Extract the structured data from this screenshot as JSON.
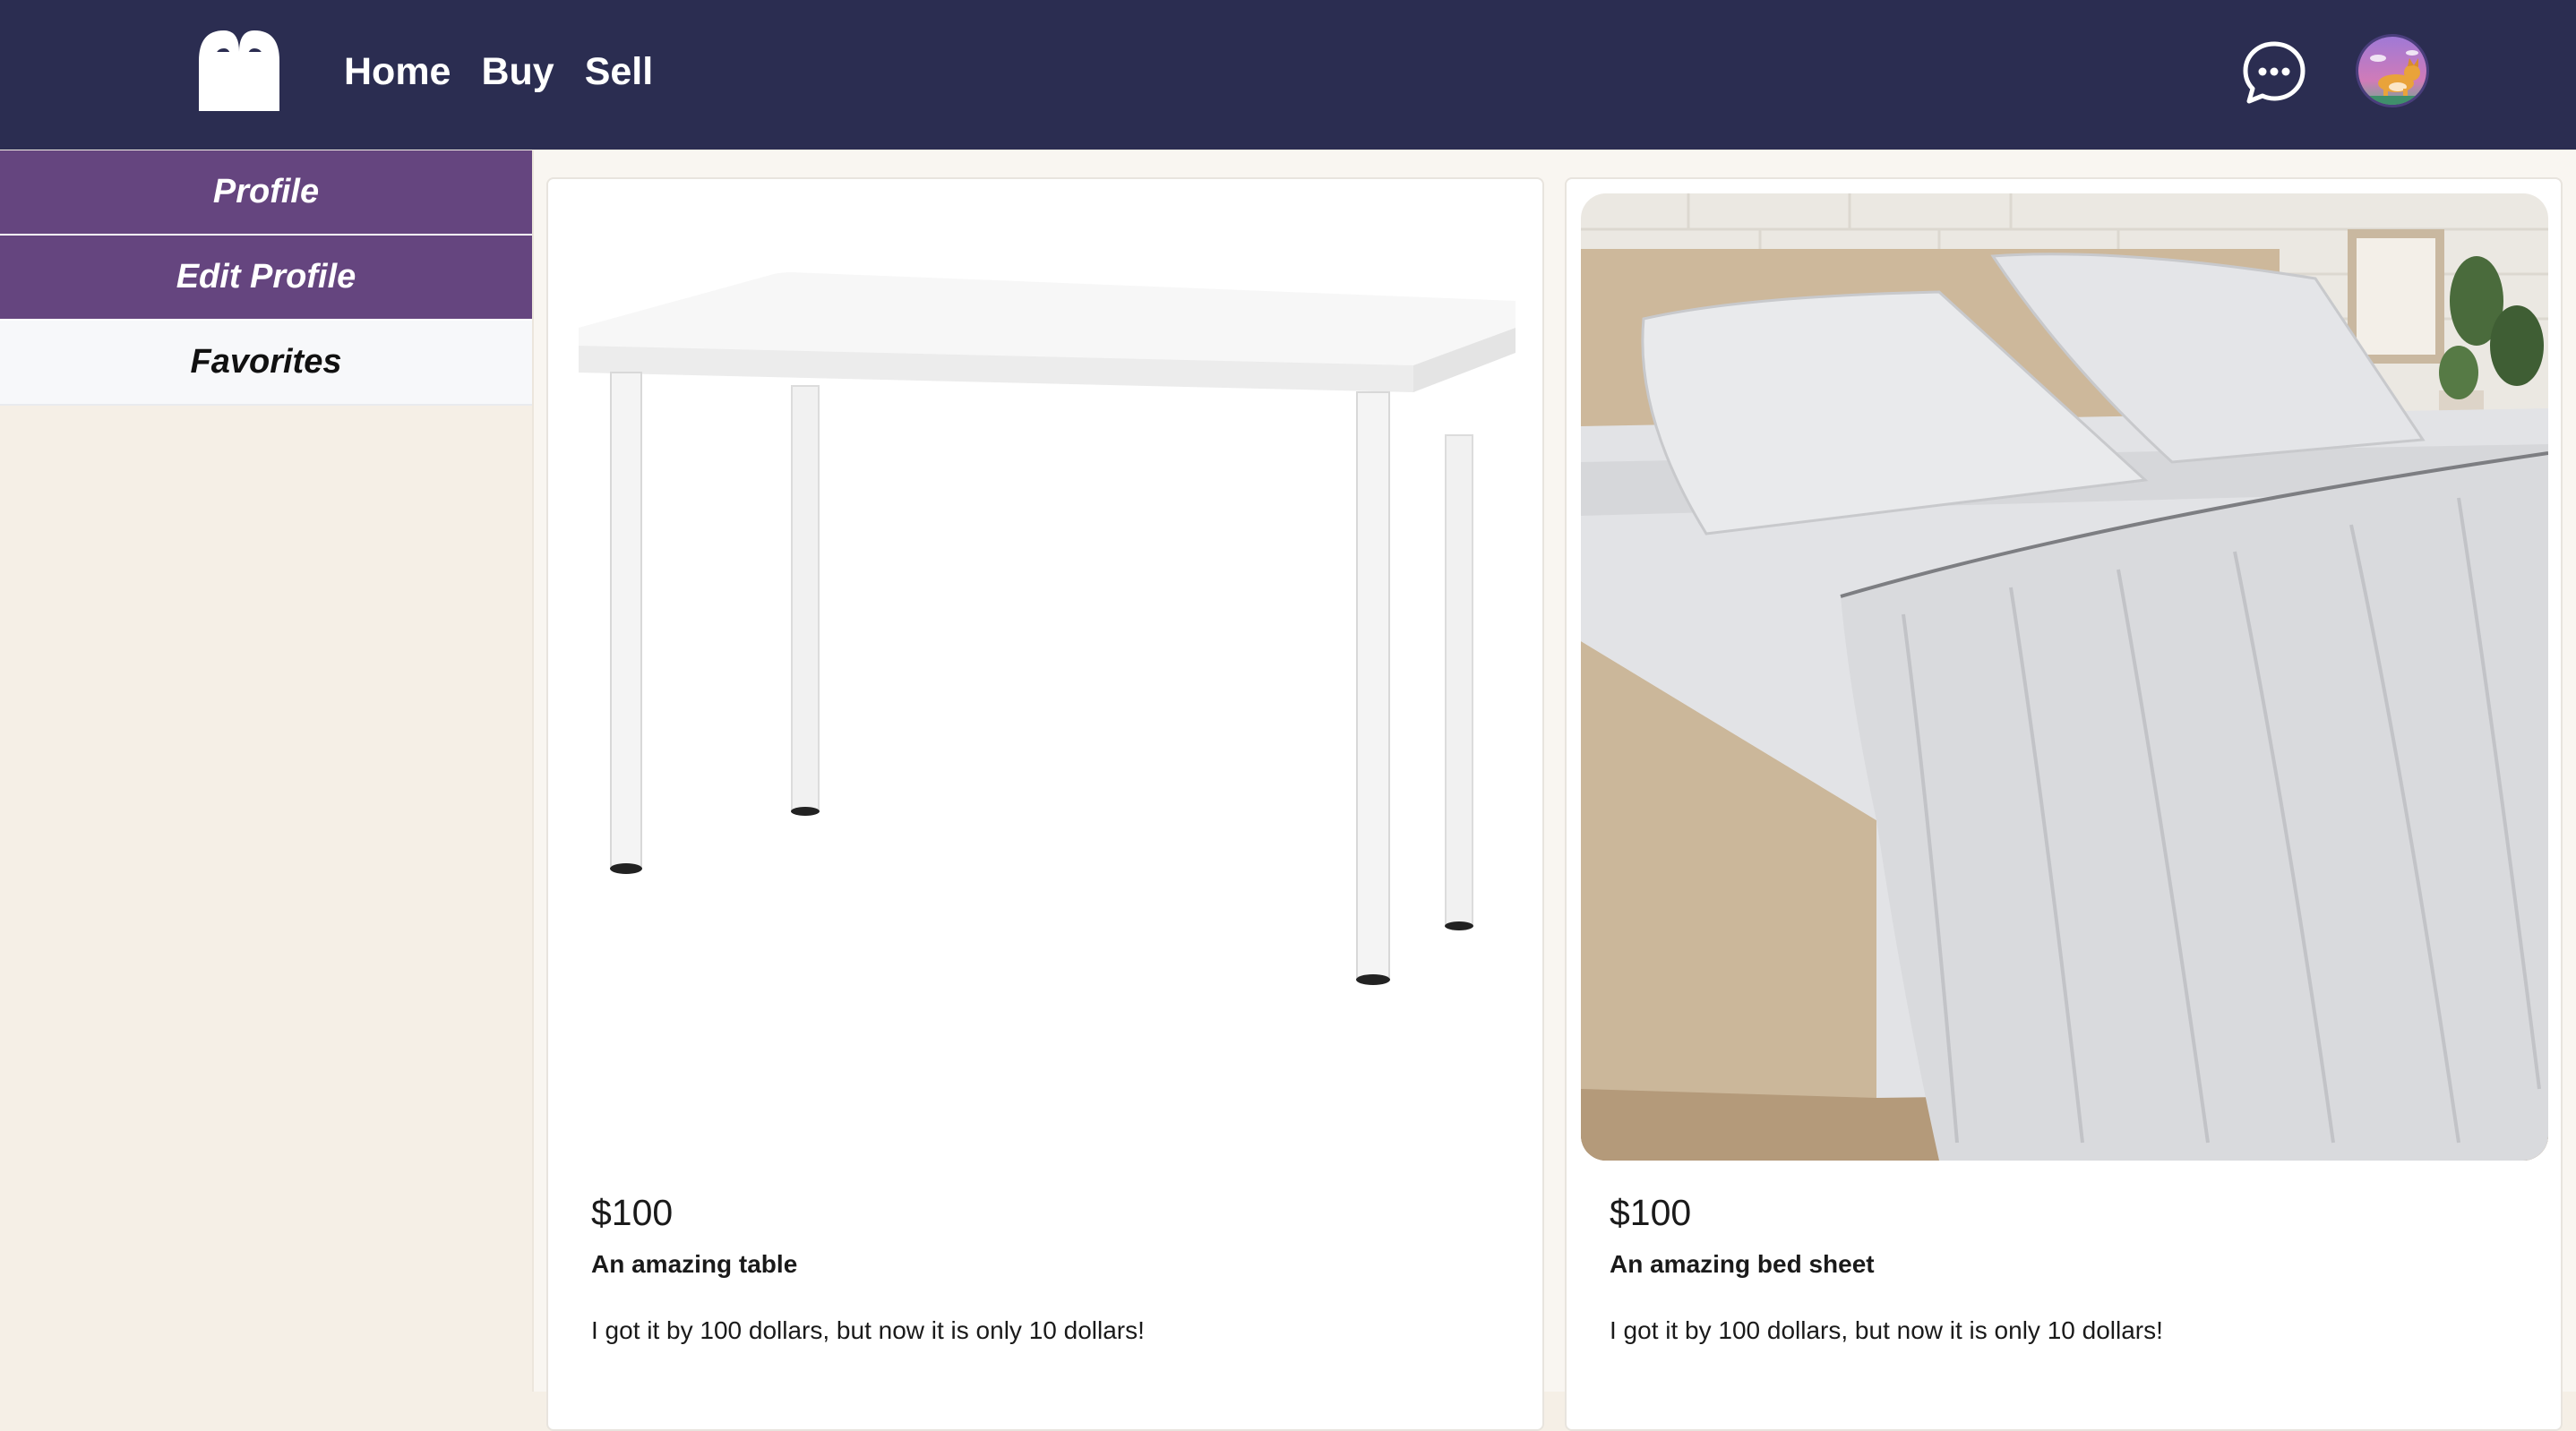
{
  "header": {
    "logo_icon": "m-logo-icon",
    "nav": [
      {
        "label": "Home"
      },
      {
        "label": "Buy"
      },
      {
        "label": "Sell"
      }
    ],
    "chat_icon": "chat-bubble-icon",
    "avatar_icon": "corgi-avatar-icon"
  },
  "sidebar": {
    "items": [
      {
        "label": "Profile",
        "state": "active"
      },
      {
        "label": "Edit Profile",
        "state": "active"
      },
      {
        "label": "Favorites",
        "state": "default"
      }
    ]
  },
  "listings": [
    {
      "image": "white-table-image",
      "price": "$100",
      "title": "An amazing table",
      "description": "I got it by 100 dollars, but now it is only 10 dollars!"
    },
    {
      "image": "bed-sheet-image",
      "price": "$100",
      "title": "An amazing bed sheet",
      "description": "I got it by 100 dollars, but now it is only 10 dollars!"
    }
  ],
  "colors": {
    "header_bg": "#2b2d51",
    "sidebar_active": "#65457f",
    "page_bg": "#f5efe6"
  }
}
